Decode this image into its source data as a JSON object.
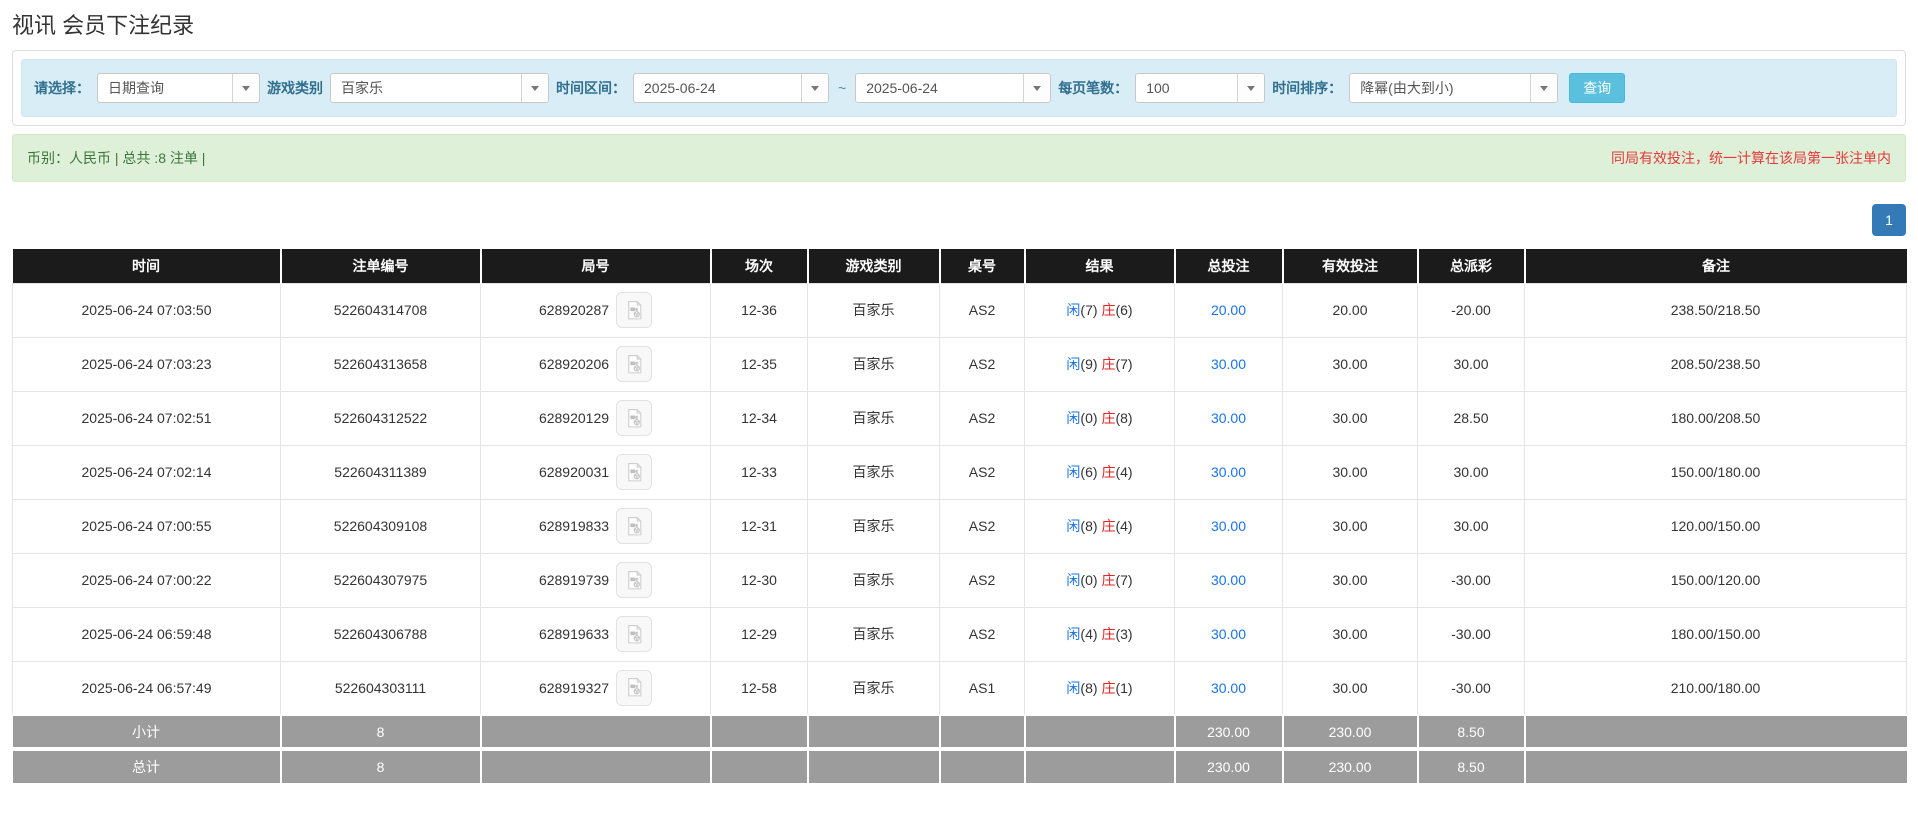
{
  "page": {
    "title": "视讯 会员下注纪录"
  },
  "filters": {
    "select_label": "请选择：",
    "select_value": "日期查询",
    "game_type_label": "游戏类别",
    "game_type_value": "百家乐",
    "time_range_label": "时间区间：",
    "date_from": "2025-06-24",
    "tilde": "~",
    "date_to": "2025-06-24",
    "page_size_label": "每页笔数：",
    "page_size_value": "100",
    "sort_label": "时间排序：",
    "sort_value": "降幂(由大到小)",
    "search_button": "查询"
  },
  "summary": {
    "left": "币别：人民币 | 总共 :8 注单 |",
    "right_note": "同局有效投注，统一计算在该局第一张注单内"
  },
  "pagination": {
    "current_page": "1"
  },
  "colors": {
    "link_blue": "#1a73e8",
    "negative_red": "#e62222",
    "search_button_cyan": "#5bc0de",
    "pagination_blue": "#337ab7",
    "header_black": "#1b1b1b",
    "footer_gray": "#9c9c9c",
    "filter_bar_blue": "#d9edf7",
    "alert_green": "#dff0d8"
  },
  "table": {
    "headers": [
      "时间",
      "注单编号",
      "局号",
      "场次",
      "游戏类别",
      "桌号",
      "结果",
      "总投注",
      "有效投注",
      "总派彩",
      "备注"
    ],
    "rows": [
      {
        "time": "2025-06-24 07:03:50",
        "bet_id": "522604314708",
        "round_id": "628920287",
        "session": "12-36",
        "game": "百家乐",
        "table_no": "AS2",
        "p_label": "闲",
        "p_score": "(7)",
        "b_label": "庄",
        "b_score": "(6)",
        "total_bet": "20.00",
        "valid_bet": "20.00",
        "payout": "-20.00",
        "remark": "238.50/218.50"
      },
      {
        "time": "2025-06-24 07:03:23",
        "bet_id": "522604313658",
        "round_id": "628920206",
        "session": "12-35",
        "game": "百家乐",
        "table_no": "AS2",
        "p_label": "闲",
        "p_score": "(9)",
        "b_label": "庄",
        "b_score": "(7)",
        "total_bet": "30.00",
        "valid_bet": "30.00",
        "payout": "30.00",
        "remark": "208.50/238.50"
      },
      {
        "time": "2025-06-24 07:02:51",
        "bet_id": "522604312522",
        "round_id": "628920129",
        "session": "12-34",
        "game": "百家乐",
        "table_no": "AS2",
        "p_label": "闲",
        "p_score": "(0)",
        "b_label": "庄",
        "b_score": "(8)",
        "total_bet": "30.00",
        "valid_bet": "30.00",
        "payout": "28.50",
        "remark": "180.00/208.50"
      },
      {
        "time": "2025-06-24 07:02:14",
        "bet_id": "522604311389",
        "round_id": "628920031",
        "session": "12-33",
        "game": "百家乐",
        "table_no": "AS2",
        "p_label": "闲",
        "p_score": "(6)",
        "b_label": "庄",
        "b_score": "(4)",
        "total_bet": "30.00",
        "valid_bet": "30.00",
        "payout": "30.00",
        "remark": "150.00/180.00"
      },
      {
        "time": "2025-06-24 07:00:55",
        "bet_id": "522604309108",
        "round_id": "628919833",
        "session": "12-31",
        "game": "百家乐",
        "table_no": "AS2",
        "p_label": "闲",
        "p_score": "(8)",
        "b_label": "庄",
        "b_score": "(4)",
        "total_bet": "30.00",
        "valid_bet": "30.00",
        "payout": "30.00",
        "remark": "120.00/150.00"
      },
      {
        "time": "2025-06-24 07:00:22",
        "bet_id": "522604307975",
        "round_id": "628919739",
        "session": "12-30",
        "game": "百家乐",
        "table_no": "AS2",
        "p_label": "闲",
        "p_score": "(0)",
        "b_label": "庄",
        "b_score": "(7)",
        "total_bet": "30.00",
        "valid_bet": "30.00",
        "payout": "-30.00",
        "remark": "150.00/120.00"
      },
      {
        "time": "2025-06-24 06:59:48",
        "bet_id": "522604306788",
        "round_id": "628919633",
        "session": "12-29",
        "game": "百家乐",
        "table_no": "AS2",
        "p_label": "闲",
        "p_score": "(4)",
        "b_label": "庄",
        "b_score": "(3)",
        "total_bet": "30.00",
        "valid_bet": "30.00",
        "payout": "-30.00",
        "remark": "180.00/150.00"
      },
      {
        "time": "2025-06-24 06:57:49",
        "bet_id": "522604303111",
        "round_id": "628919327",
        "session": "12-58",
        "game": "百家乐",
        "table_no": "AS1",
        "p_label": "闲",
        "p_score": "(8)",
        "b_label": "庄",
        "b_score": "(1)",
        "total_bet": "30.00",
        "valid_bet": "30.00",
        "payout": "-30.00",
        "remark": "210.00/180.00"
      }
    ],
    "subtotal": {
      "label": "小计",
      "count": "8",
      "total_bet": "230.00",
      "valid_bet": "230.00",
      "payout": "8.50"
    },
    "grand_total": {
      "label": "总计",
      "count": "8",
      "total_bet": "230.00",
      "valid_bet": "230.00",
      "payout": "8.50"
    }
  }
}
